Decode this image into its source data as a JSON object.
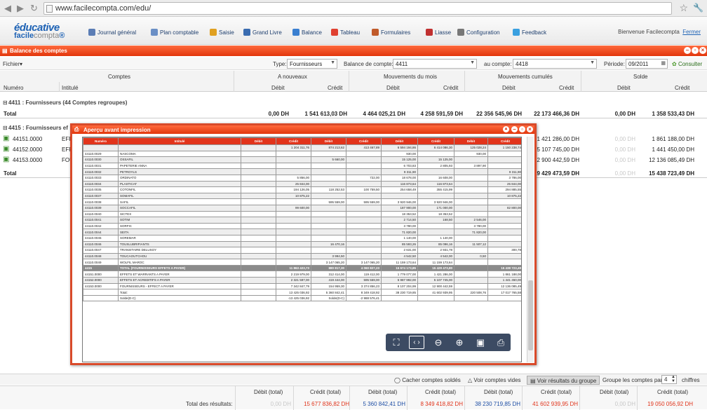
{
  "browser": {
    "url": "www.facilecompta.com/edu/"
  },
  "logo": {
    "line1": "éducative",
    "line2a": "facile",
    "line2b": "compta"
  },
  "nav": [
    {
      "label": "Journal général",
      "icon": "journal-icon",
      "color": "#5b7db5"
    },
    {
      "label": "Plan comptable",
      "icon": "plan-icon",
      "color": "#6b8fc5"
    },
    {
      "label": "Saisie",
      "icon": "pencil-icon",
      "color": "#e0a020"
    },
    {
      "label": "Grand Livre",
      "icon": "book-icon",
      "color": "#3a6cb0"
    },
    {
      "label": "Balance",
      "icon": "balance-icon",
      "color": "#3a7fd0"
    },
    {
      "label": "Tableau",
      "icon": "chart-icon",
      "color": "#e04030"
    },
    {
      "label": "Formulaires",
      "icon": "forms-icon",
      "color": "#c05a2a"
    },
    {
      "label": "Liasse",
      "icon": "liasse-icon",
      "color": "#c03030"
    },
    {
      "label": "Configuration",
      "icon": "gear-icon",
      "color": "#777777"
    },
    {
      "label": "Feedback",
      "icon": "speech-icon",
      "color": "#3aa0e0"
    }
  ],
  "welcome": {
    "text": "Bienvenue Facilecompta",
    "logout": "Fermer"
  },
  "window": {
    "title": "Balance des comptes"
  },
  "toolbar": {
    "menu": "Fichier",
    "type_label": "Type:",
    "type_value": "Fournisseurs",
    "from_label": "Balance de compte:",
    "from_value": "4411",
    "to_label": "au compte:",
    "to_value": "4418",
    "period_label": "Période:",
    "period_value": "09/2011",
    "consult": "Consulter"
  },
  "grid": {
    "groups": [
      "Comptes",
      "A nouveaux",
      "Mouvements du mois",
      "Mouvements cumulés",
      "Solde"
    ],
    "sub": [
      "Numéro",
      "Intitulé",
      "Débit",
      "Crédit",
      "Débit",
      "Crédit",
      "Débit",
      "Crédit",
      "Débit",
      "Crédit"
    ],
    "group1": "4411 : Fournisseurs (44 Comptes regroupes)",
    "total_label": "Total",
    "total1": [
      "0,00 DH",
      "1 541 613,03 DH",
      "4 464 025,21 DH",
      "4 258 591,59 DH",
      "22 356 545,96 DH",
      "22 173 466,36 DH",
      "0,00 DH",
      "1 358 533,43 DH"
    ],
    "group2": "4415 : Fournisseurs  ef",
    "rows": [
      {
        "num": "44151.0000",
        "lbl": "EFF",
        "c1": "1 421 286,00 DH",
        "c2": "0,00 DH",
        "c3": "1 861 188,00 DH"
      },
      {
        "num": "44152.0000",
        "lbl": "EFF",
        "c1": "5 107 745,00 DH",
        "c2": "0,00 DH",
        "c3": "1 441 450,00 DH"
      },
      {
        "num": "44153.0000",
        "lbl": "FOU",
        "c1": "12 900 442,59 DH",
        "c2": "0,00 DH",
        "c3": "12 136 085,49 DH"
      }
    ],
    "total2": [
      "19 429 473,59 DH",
      "0,00 DH",
      "15 438 723,49 DH"
    ]
  },
  "modal": {
    "title": "Aperçu avant impression",
    "headers": [
      "Numéro",
      "Intitulé",
      "Débit",
      "Crédit",
      "Débit",
      "Crédit",
      "Débit",
      "Crédit",
      "Débit",
      "Crédit"
    ],
    "carry": [
      "",
      "",
      "",
      "1 204 311,76",
      "874 213,62",
      "413 467,89",
      "6 594 194,86",
      "6 414 086,30",
      "125 028,24",
      "1 150 238,74"
    ],
    "rows": [
      [
        "44110.0029",
        "NASCOMA",
        "",
        "",
        "",
        "",
        "930,00",
        "",
        "930,00",
        ""
      ],
      [
        "44110.0030",
        "OSSAFIL",
        "",
        "",
        "5 660,00",
        "",
        "15 125,00",
        "15 125,00",
        "",
        ""
      ],
      [
        "44110.0031",
        "PAPETERIE ANNA",
        "",
        "",
        "",
        "",
        "6 703,83",
        "2 805,93",
        "3 897,90",
        ""
      ],
      [
        "44110.0032",
        "PETROYLS",
        "",
        "",
        "",
        "",
        "9 311,90",
        "",
        "",
        "9 311,90"
      ],
      [
        "44110.0033",
        "ORDINATO",
        "",
        "5 856,00",
        "",
        "722,00",
        "18 678,00",
        "16 608,00",
        "",
        "3 786,00"
      ],
      [
        "44110.0034",
        "PLASTICAT",
        "",
        "25 844,00",
        "",
        "",
        "116 873,64",
        "116 873,64",
        "",
        "25 844,00"
      ],
      [
        "44110.0035",
        "COTONFIL",
        "",
        "194 126,05",
        "118 252,53",
        "100 759,50",
        "254 658,49",
        "355 415,99",
        "",
        "294 885,55"
      ],
      [
        "44110.0037",
        "SOMAFIL",
        "",
        "10 875,22",
        "",
        "",
        "",
        "",
        "",
        "10 875,22"
      ],
      [
        "44110.0038",
        "SAFIL",
        "",
        "",
        "595 559,00",
        "595 559,00",
        "3 920 946,00",
        "3 920 946,00",
        "",
        ""
      ],
      [
        "44110.0039",
        "SOCCAFIL",
        "",
        "99 600,00",
        "",
        "",
        "187 900,00",
        "171 000,00",
        "",
        "82 800,00"
      ],
      [
        "44110.0040",
        "SICTEX",
        "",
        "",
        "",
        "",
        "18 353,52",
        "18 353,52",
        "",
        ""
      ],
      [
        "44110.0041",
        "SOTIM",
        "",
        "",
        "",
        "",
        "2 714,50",
        "168,50",
        "2 546,00",
        ""
      ],
      [
        "44110.0042",
        "SORFIC",
        "",
        "",
        "",
        "",
        "3 780,00",
        "",
        "3 780,00",
        ""
      ],
      [
        "44110.0044",
        "SEITA",
        "",
        "",
        "",
        "",
        "71 820,00",
        "",
        "71 820,00",
        ""
      ],
      [
        "44110.0045",
        "SOREMAR",
        "",
        "",
        "",
        "",
        "1 140,00",
        "1 140,00",
        "",
        ""
      ],
      [
        "44110.0046",
        "TOUSLUBRIFIANTS",
        "",
        "",
        "16 470,16",
        "",
        "85 593,26",
        "85 096,16",
        "11 507,12",
        ""
      ],
      [
        "44110.0047",
        "TRANSITAIRE DELUSOY",
        "",
        "",
        "",
        "",
        "2 631,00",
        "2 931,78",
        "",
        "300,78"
      ],
      [
        "44110.0048",
        "TOUCAOUTCHOU",
        "",
        "",
        "3 994,50",
        "",
        "4 542,50",
        "4 542,00",
        "0,50",
        ""
      ],
      [
        "44110.0049",
        "WOLFIL MAROC",
        "",
        "",
        "3 147 065,20",
        "3 147 065,20",
        "11 159 173,64",
        "11 159 173,64",
        "",
        ""
      ]
    ],
    "total_row": [
      "4415",
      "TOTAL (FOURNISSEURS  EFFETS A PAYER)",
      "",
      "11 863 423,73",
      "880 817,30",
      "4 060 827,23",
      "15 674 173,85",
      "15 429 473,80",
      "",
      "15 438 723,49"
    ],
    "rows2": [
      [
        "44151.0000",
        "EFFETS ET WARRANTS A PAYER",
        "",
        "2 219 979,00",
        "312 414,00",
        "119 412,00",
        "1 779 077,00",
        "1 421 286,00",
        "",
        "1 861 188,00"
      ],
      [
        "44152.0000",
        "EFFETS ET ACREDITIFS A PAYER",
        "",
        "2 321 597,00",
        "419 444,00",
        "595 559,00",
        "5 987 992,00",
        "5 107 745,00",
        "",
        "1 441 450,00"
      ],
      [
        "44153.0000",
        "FOURNISSEURS - EFFECT A PAYER",
        "",
        "7 342 847,79",
        "154 959,30",
        "3 374 856,23",
        "8 107 204,99",
        "12 900 442,59",
        "",
        "12 136 085,49"
      ]
    ],
    "totals": [
      "",
      "Total:",
      "",
      "13 425 036,92",
      "5 360 842,41",
      "8 349 418,92",
      "38 230 719,85",
      "41 602 939,95",
      "220 508,76",
      "17 017 765,58"
    ],
    "solde": [
      "",
      "Solde(D-C)",
      "",
      "-13 425 036,92",
      "Solde(D-C)",
      "-2 988 576,41",
      "",
      "",
      "",
      ""
    ]
  },
  "footer": {
    "hide": "Cacher comptes soldés",
    "show": "Voir comptes vides",
    "results": "Voir résultats du groupe",
    "group_label": "Groupe les comptes par:",
    "group_value": "4",
    "chiffres": "chiffres"
  },
  "totals": {
    "headers": [
      "Débit (total)",
      "Crédit (total)",
      "Débit (total)",
      "Crédit (total)",
      "Débit (total)",
      "Crédit (total)",
      "Débit (total)",
      "Crédit (total)"
    ],
    "label": "Total des résultats:",
    "values": [
      "0,00 DH",
      "15 677 836,82 DH",
      "5 360 842,41 DH",
      "8 349 418,82 DH",
      "38 230 719,85 DH",
      "41 602 939,95 DH",
      "0,00 DH",
      "19 050 056,92 DH"
    ]
  }
}
